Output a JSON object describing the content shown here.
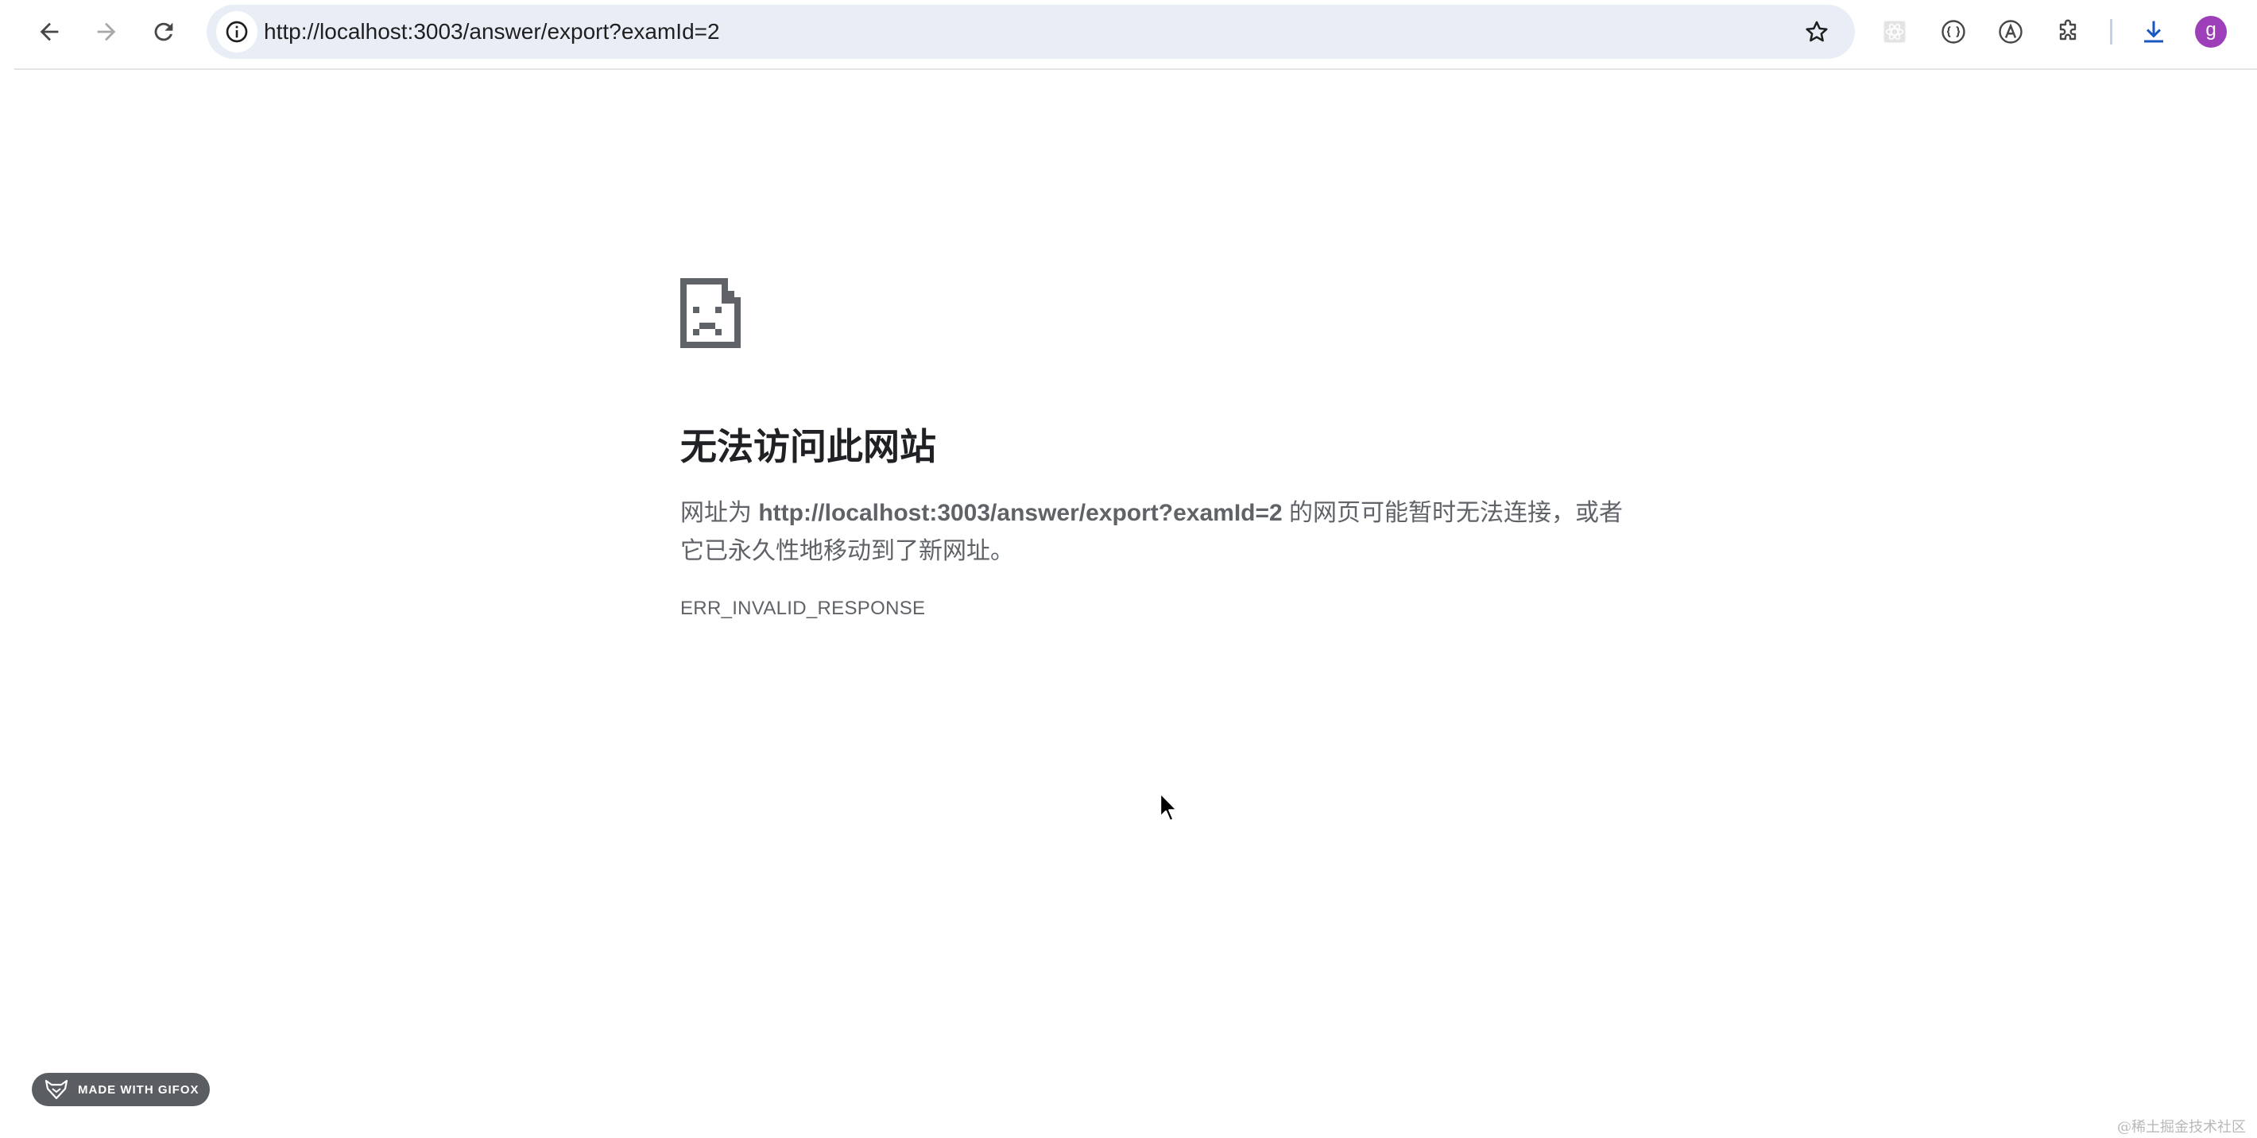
{
  "browser": {
    "url": "http://localhost:3003/answer/export?examId=2",
    "avatar_letter": "g",
    "accent_color": "#1a57c0",
    "avatar_color": "#9c3fb8"
  },
  "error": {
    "title": "无法访问此网站",
    "desc_prefix": "网址为 ",
    "desc_url": "http://localhost:3003/answer/export?examId=2",
    "desc_suffix": " 的网页可能暂时无法连接，或者它已永久性地移动到了新网址。",
    "code": "ERR_INVALID_RESPONSE"
  },
  "gifox": {
    "label": "MADE WITH GIFOX"
  },
  "watermark": {
    "text": "@稀土掘金技术社区"
  }
}
